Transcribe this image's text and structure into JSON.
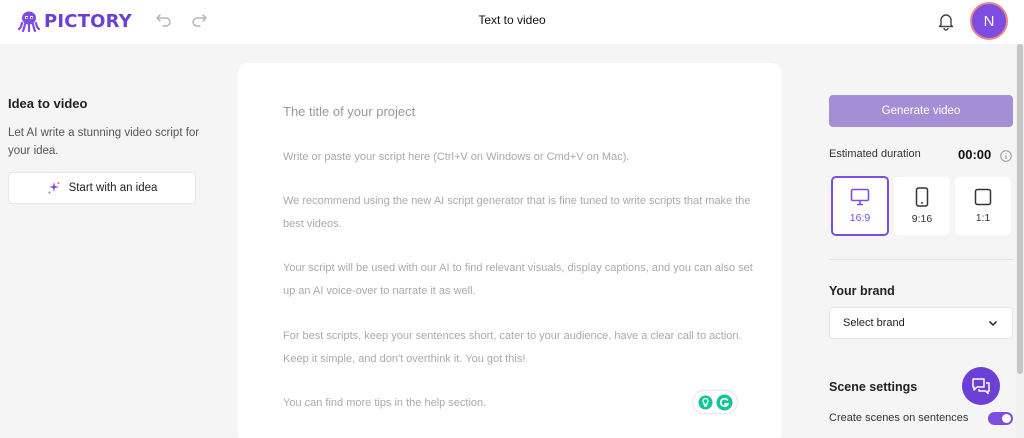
{
  "header": {
    "brand": "PICTORY",
    "title": "Text to video",
    "avatar_initial": "N"
  },
  "left_panel": {
    "title": "Idea to video",
    "description": "Let AI write a stunning video script for your idea.",
    "start_button": "Start with an idea"
  },
  "editor": {
    "title_placeholder": "The title of your project",
    "paragraphs": [
      "Write or paste your script here (Ctrl+V on Windows or Cmd+V on Mac).",
      "We recommend using the new AI script generator that is fine tuned to write scripts that make the best videos.",
      "Your script will be used with our AI to find relevant visuals, display captions, and you can also set up an AI voice-over to narrate it as well.",
      "For best scripts, keep your sentences short, cater to your audience, have a clear call to action. Keep it simple, and don't overthink it. You got this!",
      "You can find more tips in the help section."
    ]
  },
  "right_panel": {
    "generate_button": "Generate video",
    "estimated_duration_label": "Estimated duration",
    "estimated_duration_value": "00:00",
    "aspect_ratios": [
      {
        "label": "16:9",
        "icon": "monitor-icon",
        "selected": true
      },
      {
        "label": "9:16",
        "icon": "phone-icon",
        "selected": false
      },
      {
        "label": "1:1",
        "icon": "square-icon",
        "selected": false
      }
    ],
    "brand_title": "Your brand",
    "brand_select": "Select brand",
    "scene_settings_title": "Scene settings",
    "scene_toggle_label": "Create scenes on sentences",
    "scene_toggle_on": true
  },
  "colors": {
    "accent": "#7e4ce0",
    "generate_button": "#a48fd6",
    "background": "#f5f5f5"
  }
}
